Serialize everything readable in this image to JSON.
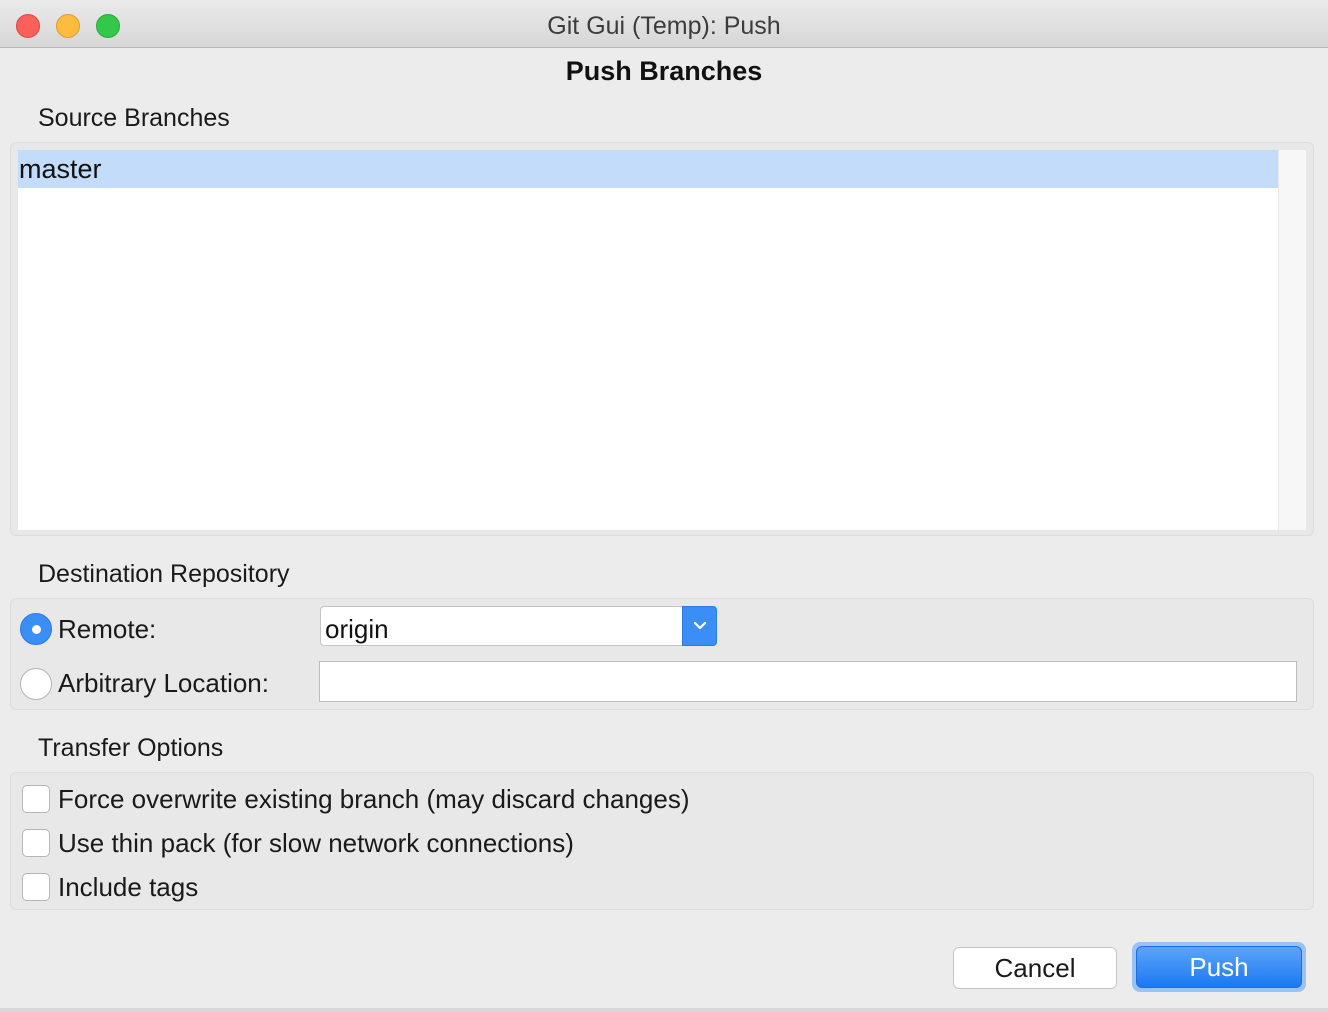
{
  "window": {
    "title": "Git Gui (Temp): Push"
  },
  "dialog": {
    "heading": "Push Branches"
  },
  "source_branches": {
    "label": "Source Branches",
    "items": [
      {
        "name": "master",
        "selected": true
      }
    ]
  },
  "destination": {
    "label": "Destination Repository",
    "remote_label": "Remote:",
    "remote_selected": true,
    "remote_value": "origin",
    "arbitrary_label": "Arbitrary Location:",
    "arbitrary_selected": false,
    "arbitrary_value": ""
  },
  "transfer_options": {
    "label": "Transfer Options",
    "options": [
      {
        "label": "Force overwrite existing branch (may discard changes)",
        "checked": false
      },
      {
        "label": "Use thin pack (for slow network connections)",
        "checked": false
      },
      {
        "label": "Include tags",
        "checked": false
      }
    ]
  },
  "buttons": {
    "cancel": "Cancel",
    "push": "Push"
  },
  "colors": {
    "accent": "#3b8ef5",
    "selection": "#c3dcf9"
  }
}
